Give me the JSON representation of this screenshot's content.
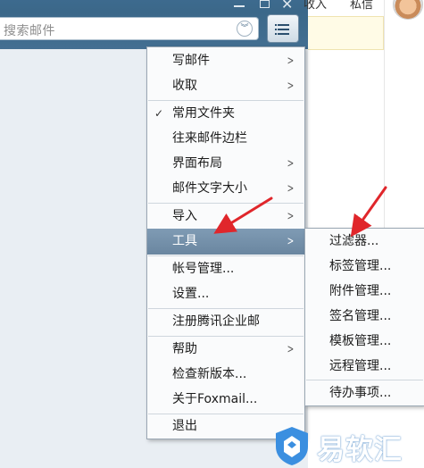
{
  "window": {
    "search_placeholder": "搜索邮件",
    "min_icon": "minimize-icon",
    "max_icon": "maximize-icon",
    "close_icon": "close-icon",
    "chevron_icon": "double-chevron-down-icon",
    "menu_icon": "menu-list-icon"
  },
  "background_page": {
    "link_1": "收入",
    "link_2": "私信"
  },
  "main_menu": {
    "items": [
      {
        "label": "写邮件",
        "submenu": true
      },
      {
        "label": "收取",
        "submenu": true
      },
      {
        "label": "常用文件夹",
        "checked": true
      },
      {
        "label": "往来邮件边栏"
      },
      {
        "label": "界面布局",
        "submenu": true
      },
      {
        "label": "邮件文字大小",
        "submenu": true
      },
      {
        "label": "导入",
        "submenu": true
      },
      {
        "label": "工具",
        "submenu": true,
        "highlighted": true
      },
      {
        "label": "帐号管理..."
      },
      {
        "label": "设置..."
      },
      {
        "label": "注册腾讯企业邮"
      },
      {
        "label": "帮助",
        "submenu": true
      },
      {
        "label": "检查新版本..."
      },
      {
        "label": "关于Foxmail..."
      },
      {
        "label": "退出"
      }
    ]
  },
  "tools_submenu": {
    "items": [
      {
        "label": "过滤器..."
      },
      {
        "label": "标签管理..."
      },
      {
        "label": "附件管理..."
      },
      {
        "label": "签名管理..."
      },
      {
        "label": "模板管理..."
      },
      {
        "label": "远程管理..."
      },
      {
        "label": "待办事项..."
      }
    ]
  },
  "watermark": {
    "text": "易软汇",
    "color": "#3b8fe0"
  },
  "colors": {
    "titlebar": "#3d6a8e",
    "highlight": "#7490aa",
    "annotation_arrow": "#e0262b"
  }
}
